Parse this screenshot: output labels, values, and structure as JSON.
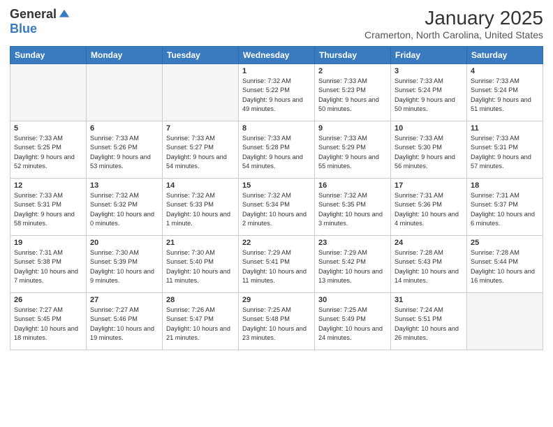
{
  "logo": {
    "general": "General",
    "blue": "Blue"
  },
  "header": {
    "month": "January 2025",
    "location": "Cramerton, North Carolina, United States"
  },
  "weekdays": [
    "Sunday",
    "Monday",
    "Tuesday",
    "Wednesday",
    "Thursday",
    "Friday",
    "Saturday"
  ],
  "weeks": [
    [
      {
        "day": "",
        "empty": true
      },
      {
        "day": "",
        "empty": true
      },
      {
        "day": "",
        "empty": true
      },
      {
        "day": "1",
        "sunrise": "7:32 AM",
        "sunset": "5:22 PM",
        "daylight": "9 hours and 49 minutes."
      },
      {
        "day": "2",
        "sunrise": "7:33 AM",
        "sunset": "5:23 PM",
        "daylight": "9 hours and 50 minutes."
      },
      {
        "day": "3",
        "sunrise": "7:33 AM",
        "sunset": "5:24 PM",
        "daylight": "9 hours and 50 minutes."
      },
      {
        "day": "4",
        "sunrise": "7:33 AM",
        "sunset": "5:24 PM",
        "daylight": "9 hours and 51 minutes."
      }
    ],
    [
      {
        "day": "5",
        "sunrise": "7:33 AM",
        "sunset": "5:25 PM",
        "daylight": "9 hours and 52 minutes."
      },
      {
        "day": "6",
        "sunrise": "7:33 AM",
        "sunset": "5:26 PM",
        "daylight": "9 hours and 53 minutes."
      },
      {
        "day": "7",
        "sunrise": "7:33 AM",
        "sunset": "5:27 PM",
        "daylight": "9 hours and 54 minutes."
      },
      {
        "day": "8",
        "sunrise": "7:33 AM",
        "sunset": "5:28 PM",
        "daylight": "9 hours and 54 minutes."
      },
      {
        "day": "9",
        "sunrise": "7:33 AM",
        "sunset": "5:29 PM",
        "daylight": "9 hours and 55 minutes."
      },
      {
        "day": "10",
        "sunrise": "7:33 AM",
        "sunset": "5:30 PM",
        "daylight": "9 hours and 56 minutes."
      },
      {
        "day": "11",
        "sunrise": "7:33 AM",
        "sunset": "5:31 PM",
        "daylight": "9 hours and 57 minutes."
      }
    ],
    [
      {
        "day": "12",
        "sunrise": "7:33 AM",
        "sunset": "5:31 PM",
        "daylight": "9 hours and 58 minutes."
      },
      {
        "day": "13",
        "sunrise": "7:32 AM",
        "sunset": "5:32 PM",
        "daylight": "10 hours and 0 minutes."
      },
      {
        "day": "14",
        "sunrise": "7:32 AM",
        "sunset": "5:33 PM",
        "daylight": "10 hours and 1 minute."
      },
      {
        "day": "15",
        "sunrise": "7:32 AM",
        "sunset": "5:34 PM",
        "daylight": "10 hours and 2 minutes."
      },
      {
        "day": "16",
        "sunrise": "7:32 AM",
        "sunset": "5:35 PM",
        "daylight": "10 hours and 3 minutes."
      },
      {
        "day": "17",
        "sunrise": "7:31 AM",
        "sunset": "5:36 PM",
        "daylight": "10 hours and 4 minutes."
      },
      {
        "day": "18",
        "sunrise": "7:31 AM",
        "sunset": "5:37 PM",
        "daylight": "10 hours and 6 minutes."
      }
    ],
    [
      {
        "day": "19",
        "sunrise": "7:31 AM",
        "sunset": "5:38 PM",
        "daylight": "10 hours and 7 minutes."
      },
      {
        "day": "20",
        "sunrise": "7:30 AM",
        "sunset": "5:39 PM",
        "daylight": "10 hours and 9 minutes."
      },
      {
        "day": "21",
        "sunrise": "7:30 AM",
        "sunset": "5:40 PM",
        "daylight": "10 hours and 11 minutes."
      },
      {
        "day": "22",
        "sunrise": "7:29 AM",
        "sunset": "5:41 PM",
        "daylight": "10 hours and 11 minutes."
      },
      {
        "day": "23",
        "sunrise": "7:29 AM",
        "sunset": "5:42 PM",
        "daylight": "10 hours and 13 minutes."
      },
      {
        "day": "24",
        "sunrise": "7:28 AM",
        "sunset": "5:43 PM",
        "daylight": "10 hours and 14 minutes."
      },
      {
        "day": "25",
        "sunrise": "7:28 AM",
        "sunset": "5:44 PM",
        "daylight": "10 hours and 16 minutes."
      }
    ],
    [
      {
        "day": "26",
        "sunrise": "7:27 AM",
        "sunset": "5:45 PM",
        "daylight": "10 hours and 18 minutes."
      },
      {
        "day": "27",
        "sunrise": "7:27 AM",
        "sunset": "5:46 PM",
        "daylight": "10 hours and 19 minutes."
      },
      {
        "day": "28",
        "sunrise": "7:26 AM",
        "sunset": "5:47 PM",
        "daylight": "10 hours and 21 minutes."
      },
      {
        "day": "29",
        "sunrise": "7:25 AM",
        "sunset": "5:48 PM",
        "daylight": "10 hours and 23 minutes."
      },
      {
        "day": "30",
        "sunrise": "7:25 AM",
        "sunset": "5:49 PM",
        "daylight": "10 hours and 24 minutes."
      },
      {
        "day": "31",
        "sunrise": "7:24 AM",
        "sunset": "5:51 PM",
        "daylight": "10 hours and 26 minutes."
      },
      {
        "day": "",
        "empty": true
      }
    ]
  ]
}
